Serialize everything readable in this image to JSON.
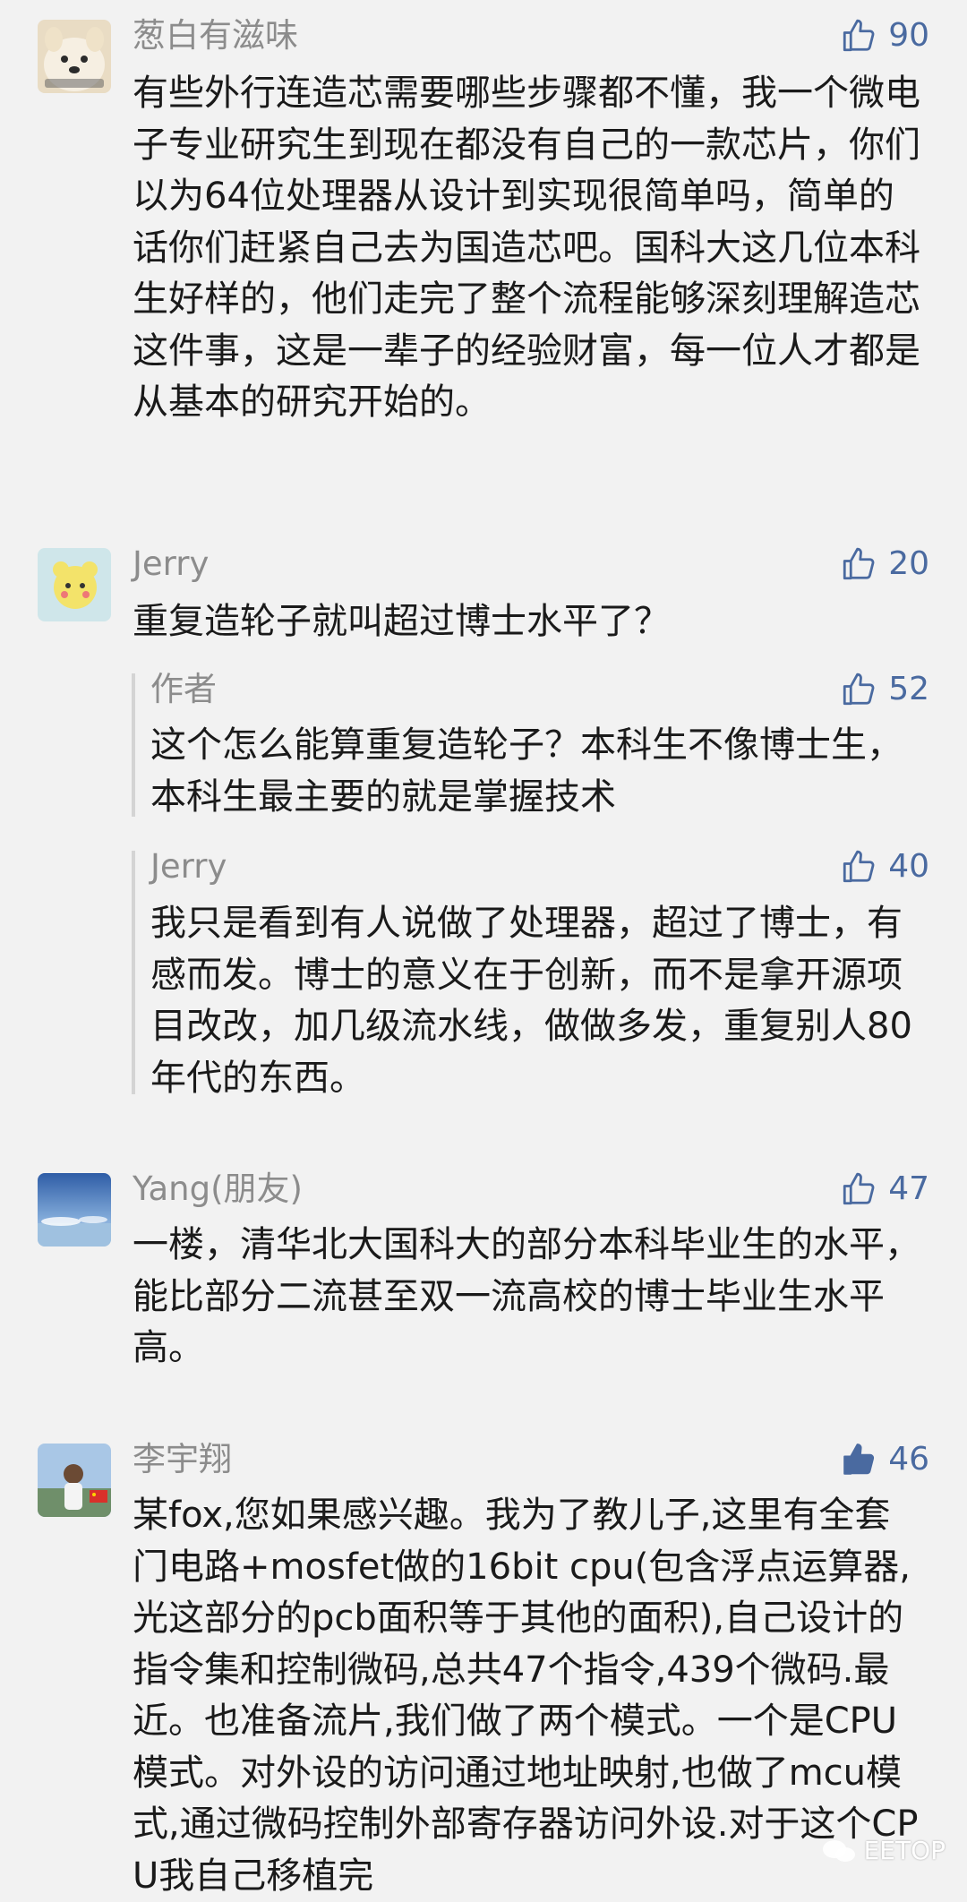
{
  "comments": [
    {
      "author": "葱白有滋味",
      "likes": "90",
      "text": "有些外行连造芯需要哪些步骤都不懂，我一个微电子专业研究生到现在都没有自己的一款芯片，你们以为64位处理器从设计到实现很简单吗，简单的话你们赶紧自己去为国造芯吧。国科大这几位本科生好样的，他们走完了整个流程能够深刻理解造芯这件事，这是一辈子的经验财富，每一位人才都是从基本的研究开始的。"
    },
    {
      "author": "Jerry",
      "likes": "20",
      "text": "重复造轮子就叫超过博士水平了？"
    },
    {
      "author": "作者",
      "likes": "52",
      "text": "这个怎么能算重复造轮子？本科生不像博士生，本科生最主要的就是掌握技术"
    },
    {
      "author": "Jerry",
      "likes": "40",
      "text": "我只是看到有人说做了处理器，超过了博士，有感而发。博士的意义在于创新，而不是拿开源项目改改，加几级流水线，做做多发，重复别人80年代的东西。"
    },
    {
      "author": "Yang(朋友)",
      "likes": "47",
      "text": "一楼，清华北大国科大的部分本科毕业生的水平，能比部分二流甚至双一流高校的博士毕业生水平高。"
    },
    {
      "author": "李宇翔",
      "likes": "46",
      "text": "某fox,您如果感兴趣。我为了教儿子,这里有全套门电路+mosfet做的16bit cpu(包含浮点运算器,光这部分的pcb面积等于其他的面积),自己设计的指令集和控制微码,总共47个指令,439个微码.最近。也准备流片,我们做了两个模式。一个是CPU模式。对外设的访问通过地址映射,也做了mcu模式,通过微码控制外部寄存器访问外设.对于这个CPU我自己移植完"
    }
  ],
  "watermark": "EETOP",
  "colors": {
    "like_blue": "#4a6aa0",
    "author_gray": "#8c8c8c",
    "text": "#1a1a1a",
    "background": "#f2f2f2"
  },
  "icons": {
    "like": "thumbs-up-outline-icon",
    "liked": "thumbs-up-filled-icon"
  }
}
